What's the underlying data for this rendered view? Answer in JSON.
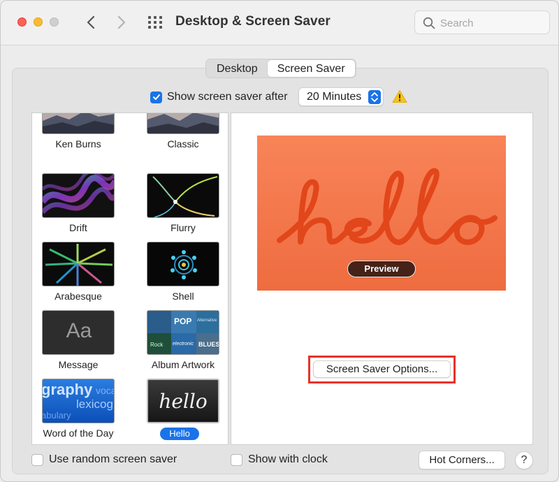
{
  "window": {
    "title": "Desktop & Screen Saver",
    "search_placeholder": "Search"
  },
  "tabs": [
    {
      "label": "Desktop",
      "active": false
    },
    {
      "label": "Screen Saver",
      "active": true
    }
  ],
  "show_after": {
    "label": "Show screen saver after",
    "checked": true,
    "duration": "20 Minutes",
    "warning_icon": "warning-triangle-icon"
  },
  "savers": [
    {
      "name": "Ken Burns",
      "selected": false
    },
    {
      "name": "Classic",
      "selected": false
    },
    {
      "name": "Drift",
      "selected": false
    },
    {
      "name": "Flurry",
      "selected": false
    },
    {
      "name": "Arabesque",
      "selected": false
    },
    {
      "name": "Shell",
      "selected": false
    },
    {
      "name": "Message",
      "selected": false,
      "thumb_text": "Aa"
    },
    {
      "name": "Album Artwork",
      "selected": false,
      "thumb_text": [
        "POP",
        "Alternative",
        "electronic",
        "BLUES",
        "Rock",
        "Classical"
      ]
    },
    {
      "name": "Word of the Day",
      "selected": false,
      "thumb_text": [
        "graphy",
        "voca",
        "lexicog",
        "abulary"
      ]
    },
    {
      "name": "Hello",
      "selected": true,
      "thumb_text": "hello"
    }
  ],
  "preview": {
    "button_label": "Preview",
    "background": "#f47a4c",
    "stroke": "#e2461b"
  },
  "options_button": "Screen Saver Options...",
  "bottom": {
    "random_label": "Use random screen saver",
    "random_checked": false,
    "clock_label": "Show with clock",
    "clock_checked": false,
    "hot_corners": "Hot Corners...",
    "help": "?"
  },
  "colors": {
    "accent": "#1a73e8",
    "highlight_box": "#e8322b",
    "warning": "#f5c518"
  }
}
